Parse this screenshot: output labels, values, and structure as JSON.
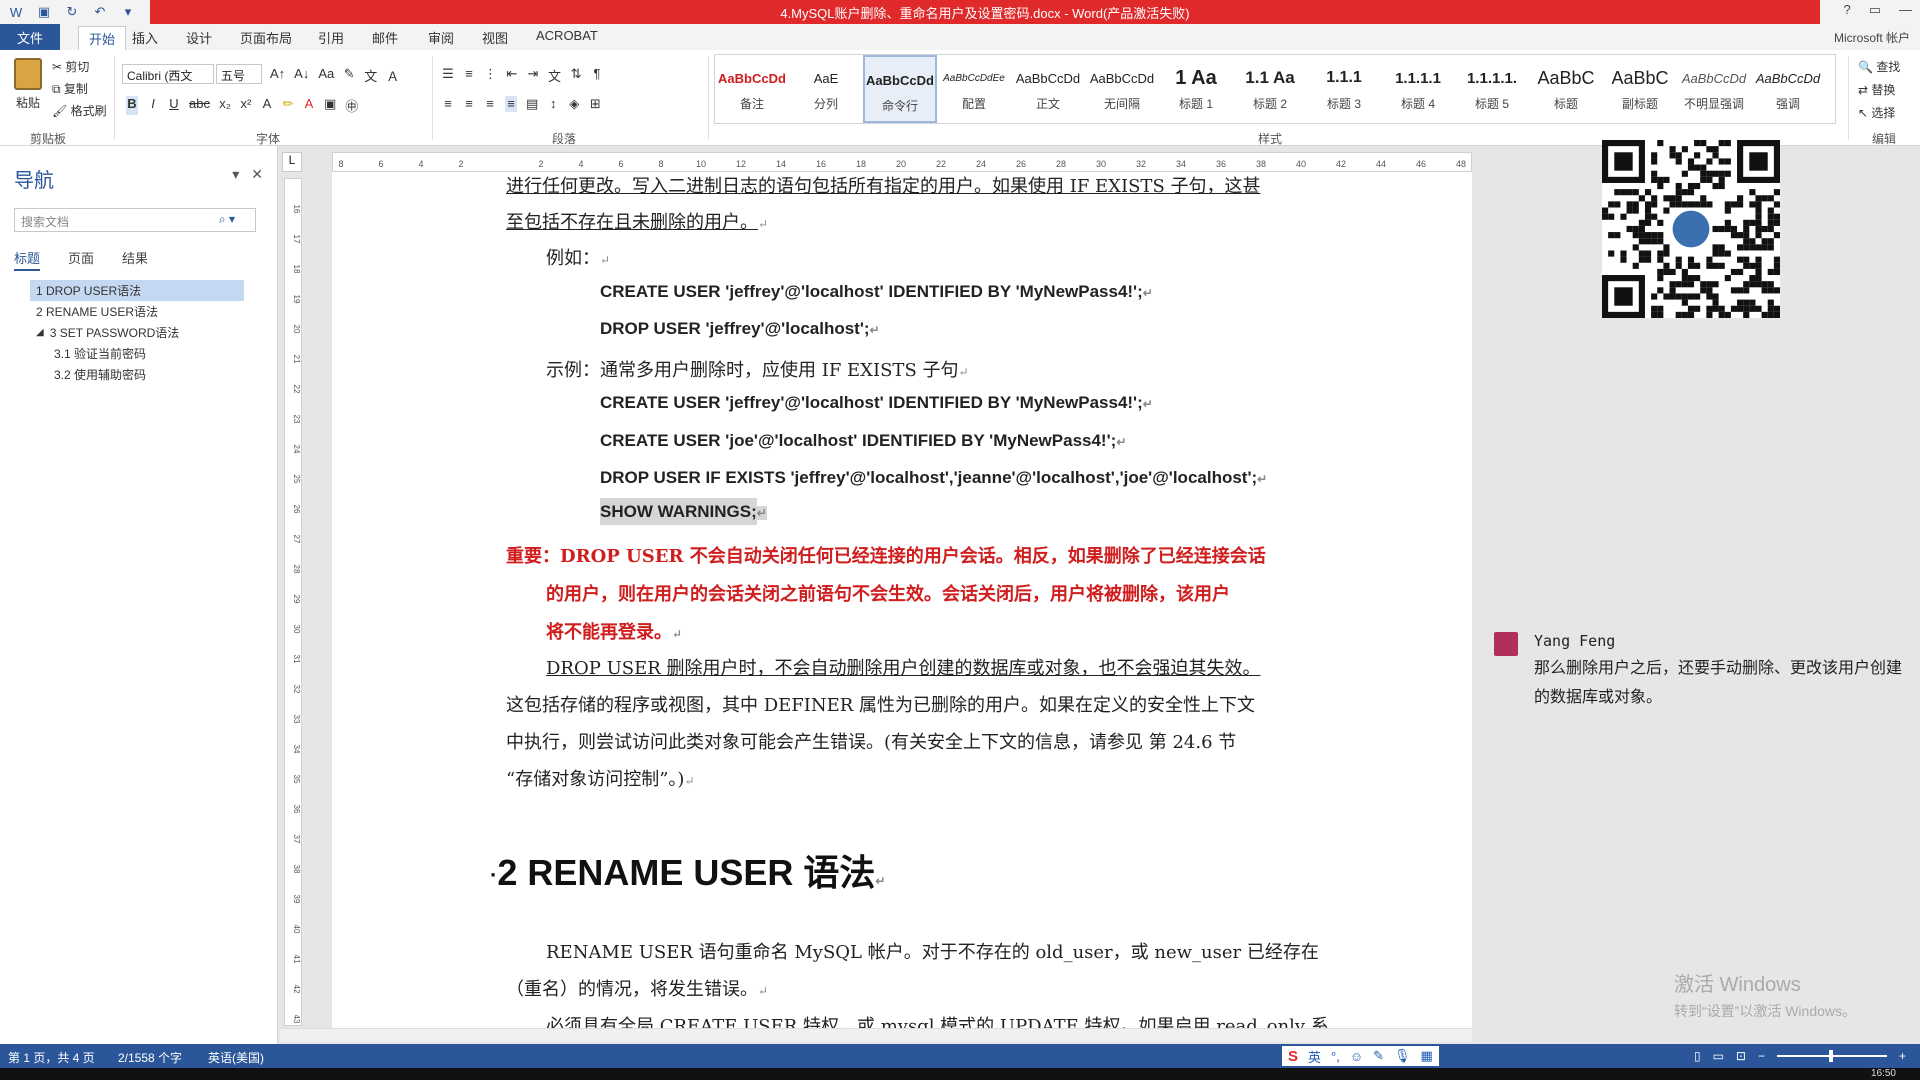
{
  "window": {
    "title": "4.MySQL账户删除、重命名用户及设置密码.docx - Word(产品激活失败)",
    "controls": [
      "?",
      "▭",
      "—"
    ]
  },
  "qat": {
    "save_icon": "save-icon",
    "redo_icon": "redo-icon",
    "undo_icon": "undo-icon"
  },
  "tabs": {
    "file": "文件",
    "items": [
      "开始",
      "插入",
      "设计",
      "页面布局",
      "引用",
      "邮件",
      "审阅",
      "视图",
      "ACROBAT"
    ],
    "active": "开始",
    "account": "Microsoft 帐户"
  },
  "ribbon": {
    "clipboard": {
      "paste": "粘贴",
      "cut": "剪切",
      "copy": "复制",
      "format_painter": "格式刷",
      "label": "剪贴板"
    },
    "font": {
      "name": "Calibri (西文",
      "size": "五号",
      "label": "字体"
    },
    "paragraph": {
      "label": "段落"
    },
    "styles": {
      "label": "样式",
      "items": [
        {
          "sample": "AaBbCcDd",
          "name": "备注"
        },
        {
          "sample": "AaE",
          "name": "分列"
        },
        {
          "sample": "AaBbCcDd",
          "name": "命令行"
        },
        {
          "sample": "AaBbCcDdEe",
          "name": "配置"
        },
        {
          "sample": "AaBbCcDd",
          "name": "正文"
        },
        {
          "sample": "AaBbCcDd",
          "name": "无间隔"
        },
        {
          "sample": "1  Aa",
          "name": "标题 1"
        },
        {
          "sample": "1.1  Aa",
          "name": "标题 2"
        },
        {
          "sample": "1.1.1",
          "name": "标题 3"
        },
        {
          "sample": "1.1.1.1",
          "name": "标题 4"
        },
        {
          "sample": "1.1.1.1.",
          "name": "标题 5"
        },
        {
          "sample": "AaBbC",
          "name": "标题"
        },
        {
          "sample": "AaBbC",
          "name": "副标题"
        },
        {
          "sample": "AaBbCcDd",
          "name": "不明显强调"
        },
        {
          "sample": "AaBbCcDd",
          "name": "强调"
        }
      ],
      "selected": "命令行"
    },
    "editing": {
      "find": "查找",
      "replace": "替换",
      "select": "选择",
      "label": "编辑"
    }
  },
  "nav": {
    "title": "导航",
    "search_placeholder": "搜索文档",
    "tabs": [
      "标题",
      "页面",
      "结果"
    ],
    "items": [
      {
        "text": "1 DROP USER语法",
        "level": 1,
        "selected": true
      },
      {
        "text": "2 RENAME USER语法",
        "level": 1
      },
      {
        "text": "3 SET PASSWORD语法",
        "level": 1,
        "expanded": true
      },
      {
        "text": "3.1 验证当前密码",
        "level": 2
      },
      {
        "text": "3.2 使用辅助密码",
        "level": 2
      }
    ]
  },
  "ruler": {
    "corner": "L",
    "h_ticks": [
      "8",
      "6",
      "4",
      "2",
      "",
      "2",
      "4",
      "6",
      "8",
      "10",
      "12",
      "14",
      "16",
      "18",
      "20",
      "22",
      "24",
      "26",
      "28",
      "30",
      "32",
      "34",
      "36",
      "38",
      "40",
      "42",
      "44",
      "46",
      "48"
    ],
    "v_ticks": [
      "16",
      "17",
      "18",
      "19",
      "20",
      "21",
      "22",
      "23",
      "24",
      "25",
      "26",
      "27",
      "28",
      "29",
      "30",
      "31",
      "32",
      "33",
      "34",
      "35",
      "36",
      "37",
      "38",
      "39",
      "40",
      "41",
      "42",
      "43"
    ]
  },
  "doc": {
    "line1_a": "进行任何更改。写入二进制日志的语句包括所有指定的用户。如果使用 IF EXISTS 子句，这甚",
    "line2": "至包括不存在且未删除的用户。",
    "example_label": "例如：",
    "code1": "CREATE USER 'jeffrey'@'localhost' IDENTIFIED BY 'MyNewPass4!';",
    "code2": "DROP USER 'jeffrey'@'localhost';",
    "note": "示例：通常多用户删除时，应使用 IF EXISTS 子句",
    "code3": "CREATE USER 'jeffrey'@'localhost' IDENTIFIED BY 'MyNewPass4!';",
    "code4": "CREATE USER 'joe'@'localhost' IDENTIFIED BY 'MyNewPass4!';",
    "code5": "DROP USER IF EXISTS 'jeffrey'@'localhost','jeanne'@'localhost','joe'@'localhost';",
    "code6": "SHOW WARNINGS;",
    "important_1": "重要：DROP USER 不会自动关闭任何已经连接的用户会话。相反，如果删除了已经连接会话",
    "important_2": "的用户，则在用户的会话关闭之前语句不会生效。会话关闭后，用户将被删除，该用户",
    "important_3": "将不能再登录。",
    "para2_1": "DROP USER 删除用户时，不会自动删除用户创建的数据库或对象，也不会强迫其失效。",
    "para2_2": "这包括存储的程序或视图，其中 DEFINER 属性为已删除的用户。如果在定义的安全性上下文",
    "para2_3": "中执行，则尝试访问此类对象可能会产生错误。(有关安全上下文的信息，请参见  第 24.6 节",
    "para2_4": "“存储对象访问控制”。)",
    "heading2": "2  RENAME USER 语法",
    "para3_1": "RENAME USER 语句重命名 MySQL 帐户。对于不存在的 old_user，或 new_user 已经存在",
    "para3_2": "（重名）的情况，将发生错误。",
    "para3_3": "必须具有全局 CREATE USER 特权，或 mysql 模式的 UPDATE 特权。如果启用 read_only 系"
  },
  "comment": {
    "author": "Yang Feng",
    "text": "那么删除用户之后，还要手动删除、更改该用户创建的数据库或对象。"
  },
  "watermark": {
    "line1": "激活 Windows",
    "line2": "转到“设置”以激活 Windows。"
  },
  "status": {
    "page": "第 1 页，共 4 页",
    "words": "2/1558 个字",
    "lang": "英语(美国)",
    "ime": "英"
  },
  "taskbar": {
    "time": "16:50"
  },
  "colors": {
    "accent": "#2b579a",
    "title_red": "#e0292b",
    "important_red": "#d01d1d"
  }
}
